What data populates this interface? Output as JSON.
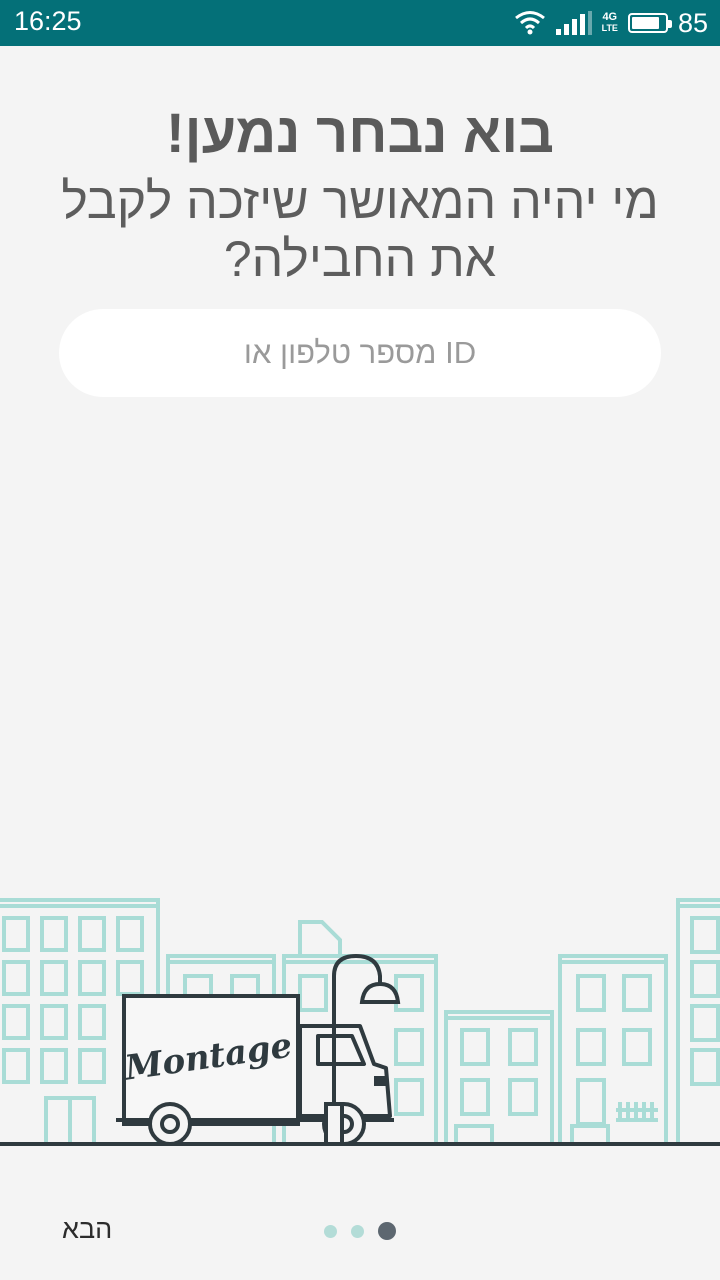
{
  "status_bar": {
    "time": "16:25",
    "network_top": "4G",
    "network_bottom": "LTE",
    "battery_level": "85",
    "battery_fraction": 0.85
  },
  "main": {
    "title": "בוא נבחר נמען!",
    "subtitle": "מי יהיה המאושר שיזכה לקבל את החבילה?",
    "input_placeholder": "ID מספר טלפון או",
    "input_value": ""
  },
  "illustration": {
    "truck_logo": "Montage",
    "building_color": "#a9dcd6",
    "ink_color": "#2f3a3f"
  },
  "footer": {
    "next_label": "הבא",
    "page_count": 3,
    "active_page": 3
  },
  "colors": {
    "status_bar": "#047078",
    "background": "#f4f4f4",
    "dot_inactive": "#b3dcd7",
    "dot_active": "#5d6770"
  }
}
